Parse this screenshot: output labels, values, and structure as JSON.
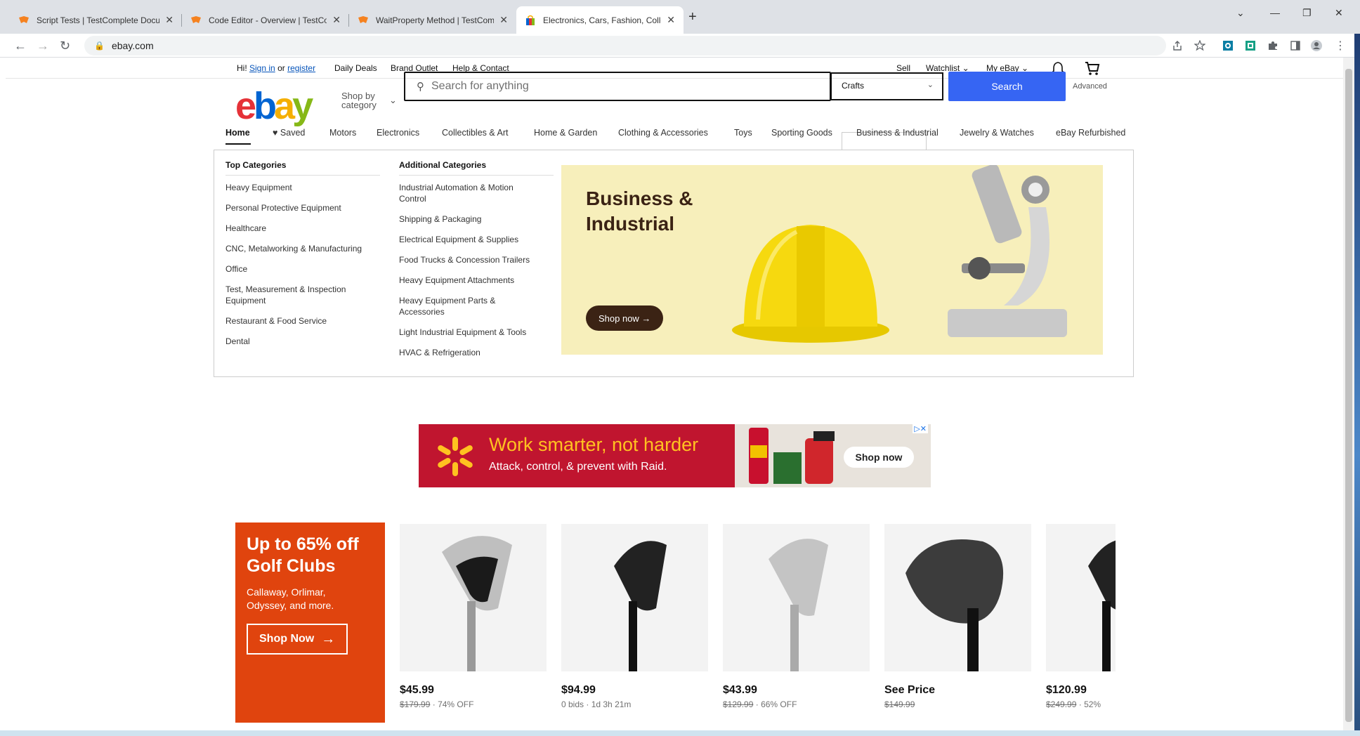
{
  "browser": {
    "tabs": [
      {
        "title": "Script Tests | TestComplete Docu"
      },
      {
        "title": "Code Editor - Overview | TestCom"
      },
      {
        "title": "WaitProperty Method | TestComp"
      },
      {
        "title": "Electronics, Cars, Fashion, Collect"
      }
    ],
    "url": "ebay.com"
  },
  "topnav": {
    "greeting": "Hi!",
    "sign_in": "Sign in",
    "or": "or",
    "register": "register",
    "daily_deals": "Daily Deals",
    "brand_outlet": "Brand Outlet",
    "help": "Help & Contact",
    "sell": "Sell",
    "watchlist": "Watchlist",
    "my_ebay": "My eBay"
  },
  "header": {
    "logo": {
      "e": "e",
      "b": "b",
      "a": "a",
      "y": "y"
    },
    "shop_by_line1": "Shop by",
    "shop_by_line2": "category",
    "search_placeholder": "Search for anything",
    "category_selected": "Crafts",
    "search_button": "Search",
    "advanced": "Advanced"
  },
  "catnav": {
    "items": [
      "Home",
      "Saved",
      "Motors",
      "Electronics",
      "Collectibles & Art",
      "Home & Garden",
      "Clothing & Accessories",
      "Toys",
      "Sporting Goods",
      "Business & Industrial",
      "Jewelry & Watches",
      "eBay Refurbished"
    ]
  },
  "dropdown": {
    "top_heading": "Top Categories",
    "top": [
      "Heavy Equipment",
      "Personal Protective Equipment",
      "Healthcare",
      "CNC, Metalworking & Manufacturing",
      "Office",
      "Test, Measurement & Inspection Equipment",
      "Restaurant & Food Service",
      "Dental"
    ],
    "additional_heading": "Additional Categories",
    "additional": [
      "Industrial Automation & Motion Control",
      "Shipping & Packaging",
      "Electrical Equipment & Supplies",
      "Food Trucks & Concession Trailers",
      "Heavy Equipment Attachments",
      "Heavy Equipment Parts & Accessories",
      "Light Industrial Equipment & Tools",
      "HVAC & Refrigeration"
    ],
    "banner_title_1": "Business &",
    "banner_title_2": "Industrial",
    "banner_button": "Shop now →"
  },
  "ad": {
    "headline": "Work smarter, not harder",
    "sub": "Attack, control, & prevent with Raid.",
    "button": "Shop now"
  },
  "promo": {
    "title_1": "Up to 65% off",
    "title_2": "Golf Clubs",
    "sub_1": "Callaway, Orlimar,",
    "sub_2": "Odyssey, and more.",
    "button": "Shop Now"
  },
  "items": [
    {
      "price": "$45.99",
      "was": "$179.99",
      "extra": "74% OFF"
    },
    {
      "price": "$94.99",
      "was": "0 bids",
      "extra": "1d 3h 21m"
    },
    {
      "price": "$43.99",
      "was": "$129.99",
      "extra": "66% OFF"
    },
    {
      "price": "See Price",
      "was": "$149.99",
      "extra": ""
    },
    {
      "price": "$120.99",
      "was": "$249.99",
      "extra": "52%"
    }
  ],
  "colors": {
    "ebay_blue": "#3665f3",
    "promo_orange": "#e0440e",
    "ad_red": "#c0152f",
    "banner_yellow": "#f7efbb"
  }
}
